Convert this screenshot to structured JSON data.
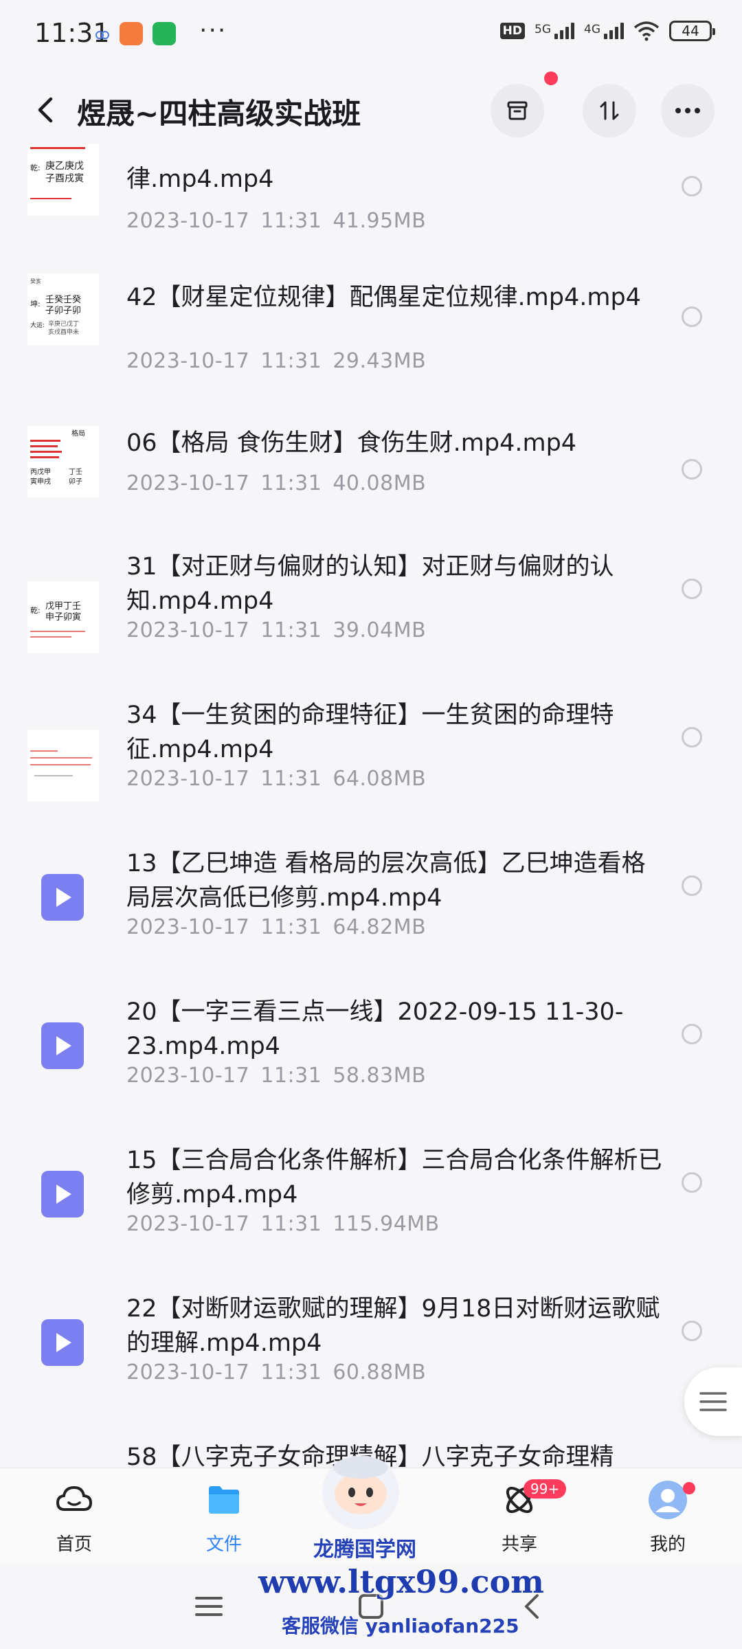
{
  "status": {
    "time": "11:31",
    "hd": "HD",
    "net1": "5G",
    "net2": "4G",
    "battery": "44",
    "more": "···"
  },
  "header": {
    "title": "煜晟~四柱高级实战班"
  },
  "files": [
    {
      "name": "律.mp4.mp4",
      "date": "2023-10-17",
      "time": "11:31",
      "size": "41.95MB"
    },
    {
      "name": "42【财星定位规律】配偶星定位规律.mp4.mp4",
      "date": "2023-10-17",
      "time": "11:31",
      "size": "29.43MB"
    },
    {
      "name": "06【格局  食伤生财】食伤生财.mp4.mp4",
      "date": "2023-10-17",
      "time": "11:31",
      "size": "40.08MB"
    },
    {
      "name": "31【对正财与偏财的认知】对正财与偏财的认知.mp4.mp4",
      "date": "2023-10-17",
      "time": "11:31",
      "size": "39.04MB"
    },
    {
      "name": "34【一生贫困的命理特征】一生贫困的命理特征.mp4.mp4",
      "date": "2023-10-17",
      "time": "11:31",
      "size": "64.08MB"
    },
    {
      "name": "13【乙巳坤造  看格局的层次高低】乙巳坤造看格局层次高低已修剪.mp4.mp4",
      "date": "2023-10-17",
      "time": "11:31",
      "size": "64.82MB"
    },
    {
      "name": "20【一字三看三点一线】2022-09-15 11-30-23.mp4.mp4",
      "date": "2023-10-17",
      "time": "11:31",
      "size": "58.83MB"
    },
    {
      "name": "15【三合局合化条件解析】三合局合化条件解析已修剪.mp4.mp4",
      "date": "2023-10-17",
      "time": "11:31",
      "size": "115.94MB"
    },
    {
      "name": "22【对断财运歌赋的理解】9月18日对断财运歌赋的理解.mp4.mp4",
      "date": "2023-10-17",
      "time": "11:31",
      "size": "60.88MB"
    },
    {
      "name": "58【八字克子女命理精解】八字克子女命理精",
      "date": "",
      "time": "",
      "size": ""
    }
  ],
  "nav": {
    "home": "首页",
    "files": "文件",
    "share": "共享",
    "share_badge": "99+",
    "mine": "我的"
  },
  "watermark": {
    "line1": "龙腾国学网",
    "line2": "www.ltgx99.com",
    "line3": "客服微信 yanliaofan225"
  },
  "colors": {
    "accent": "#2a82f5",
    "video_icon": "#7b7ff0",
    "badge": "#ff3b5c"
  }
}
